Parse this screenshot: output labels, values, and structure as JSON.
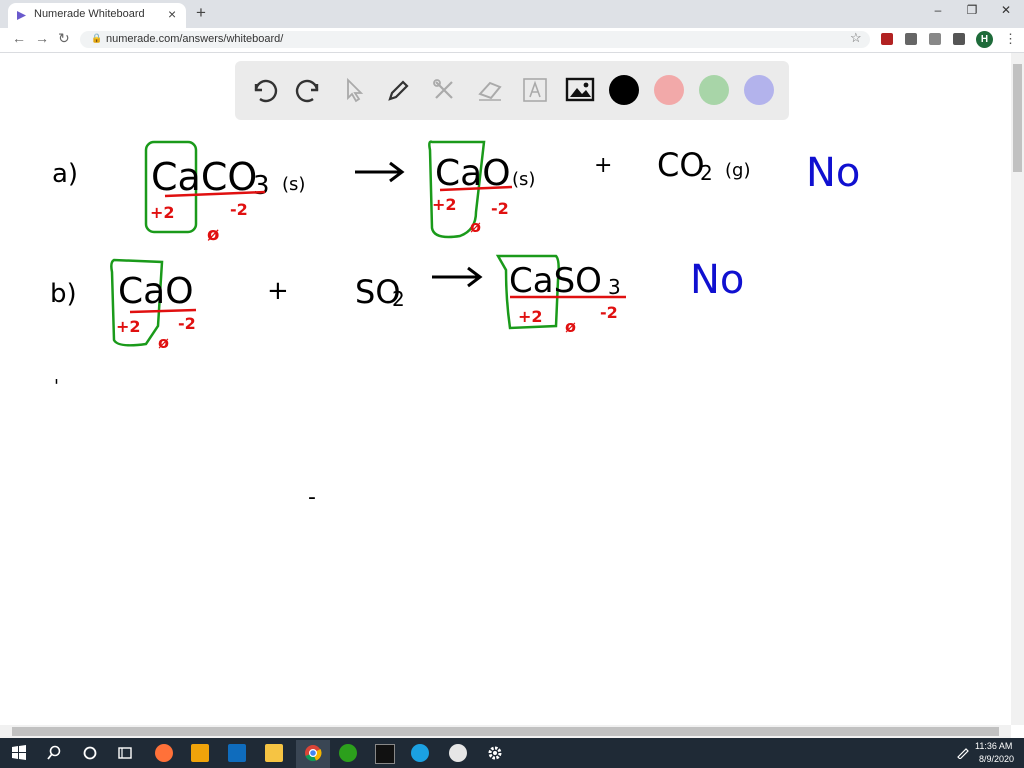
{
  "browser": {
    "tab_title": "Numerade Whiteboard",
    "tab_close": "×",
    "new_tab": "+",
    "url": "numerade.com/answers/whiteboard/",
    "profile_initial": "H",
    "window_controls": [
      "–",
      "❐",
      "✕"
    ]
  },
  "toolbar": {
    "tools": [
      "undo-icon",
      "redo-icon",
      "select-pointer-icon",
      "pen-icon",
      "tools-icon",
      "eraser-icon",
      "text-icon",
      "image-icon"
    ],
    "colors": [
      "#000000",
      "#f2a9a9",
      "#a8d5a8",
      "#b3b3ec"
    ],
    "selected_color": "#000000"
  },
  "whiteboard": {
    "part_a": {
      "label": "a)",
      "reactant": "CaCO",
      "reactant_sub": "3",
      "reactant_state": "(s)",
      "ca_ox": "+2",
      "c_ox": "ø",
      "o_ox": "-2",
      "product1": "CaO",
      "product1_state": "(s)",
      "p1_ca_ox": "+2",
      "p1_c_ox": "ø",
      "p1_o_ox": "-2",
      "plus": "+",
      "product2": "CO",
      "product2_sub": "2",
      "product2_state": "(g)",
      "answer": "No"
    },
    "part_b": {
      "label": "b)",
      "reactant1": "CaO",
      "r1_ca_ox": "+2",
      "r1_mid_ox": "ø",
      "r1_o_ox": "-2",
      "plus": "+",
      "reactant2": "SO",
      "reactant2_sub": "2",
      "product": "CaSO",
      "product_sub": "3",
      "p_ca_ox": "+2",
      "p_mid_ox": "ø",
      "p_o_ox": "-2",
      "answer": "No"
    },
    "stray_marks": [
      "'",
      "-"
    ]
  },
  "taskbar": {
    "time": "11:36 AM",
    "date": "8/9/2020",
    "icons": [
      "windows-start-icon",
      "search-icon",
      "cortana-icon",
      "task-view-icon",
      "firefox-icon",
      "store-icon",
      "mail-icon",
      "file-explorer-icon",
      "chrome-icon",
      "quickbooks-icon",
      "terminal-icon",
      "edge-icon",
      "app-icon",
      "settings-icon"
    ]
  }
}
